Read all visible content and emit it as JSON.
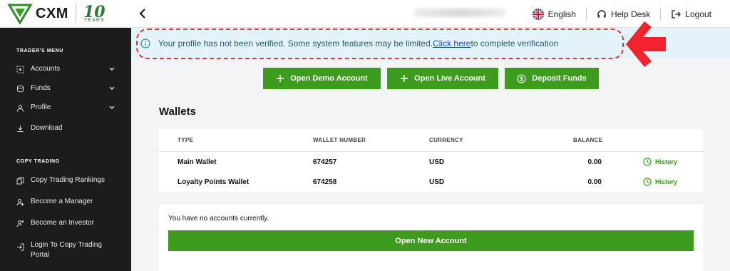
{
  "brand": {
    "name": "CXM",
    "anniversary_number": "10",
    "anniversary_text": "YEARS",
    "accent_color": "#3d9b1d"
  },
  "header": {
    "language": "English",
    "help_desk": "Help Desk",
    "logout": "Logout"
  },
  "sidebar": {
    "traders_menu_heading": "TRADER'S MENU",
    "traders_items": [
      {
        "label": "Accounts",
        "icon": "accounts-icon",
        "expandable": true
      },
      {
        "label": "Funds",
        "icon": "funds-icon",
        "expandable": true
      },
      {
        "label": "Profile",
        "icon": "profile-icon",
        "expandable": true
      },
      {
        "label": "Download",
        "icon": "download-icon",
        "expandable": false
      }
    ],
    "copy_trading_heading": "COPY TRADING",
    "copy_items": [
      {
        "label": "Copy Trading Rankings",
        "icon": "rankings-icon"
      },
      {
        "label": "Become a Manager",
        "icon": "add-user-icon"
      },
      {
        "label": "Become an Investor",
        "icon": "investor-icon"
      },
      {
        "label": "Login To Copy Trading Portal",
        "icon": "login-icon"
      }
    ]
  },
  "banner": {
    "message": "Your profile has not been verified. Some system features may be limited.",
    "link_text": "Click here",
    "suffix": "to complete verification"
  },
  "actions": {
    "open_demo": "Open Demo Account",
    "open_live": "Open Live Account",
    "deposit": "Deposit Funds"
  },
  "wallets": {
    "title": "Wallets",
    "columns": [
      "TYPE",
      "WALLET NUMBER",
      "CURRENCY",
      "BALANCE"
    ],
    "rows": [
      {
        "type": "Main Wallet",
        "number": "674257",
        "currency": "USD",
        "balance": "0.00",
        "action": "History"
      },
      {
        "type": "Loyalty Points Wallet",
        "number": "674258",
        "currency": "USD",
        "balance": "0.00",
        "action": "History"
      }
    ]
  },
  "accounts": {
    "empty_message": "You have no accounts currently.",
    "open_new": "Open New Account"
  }
}
